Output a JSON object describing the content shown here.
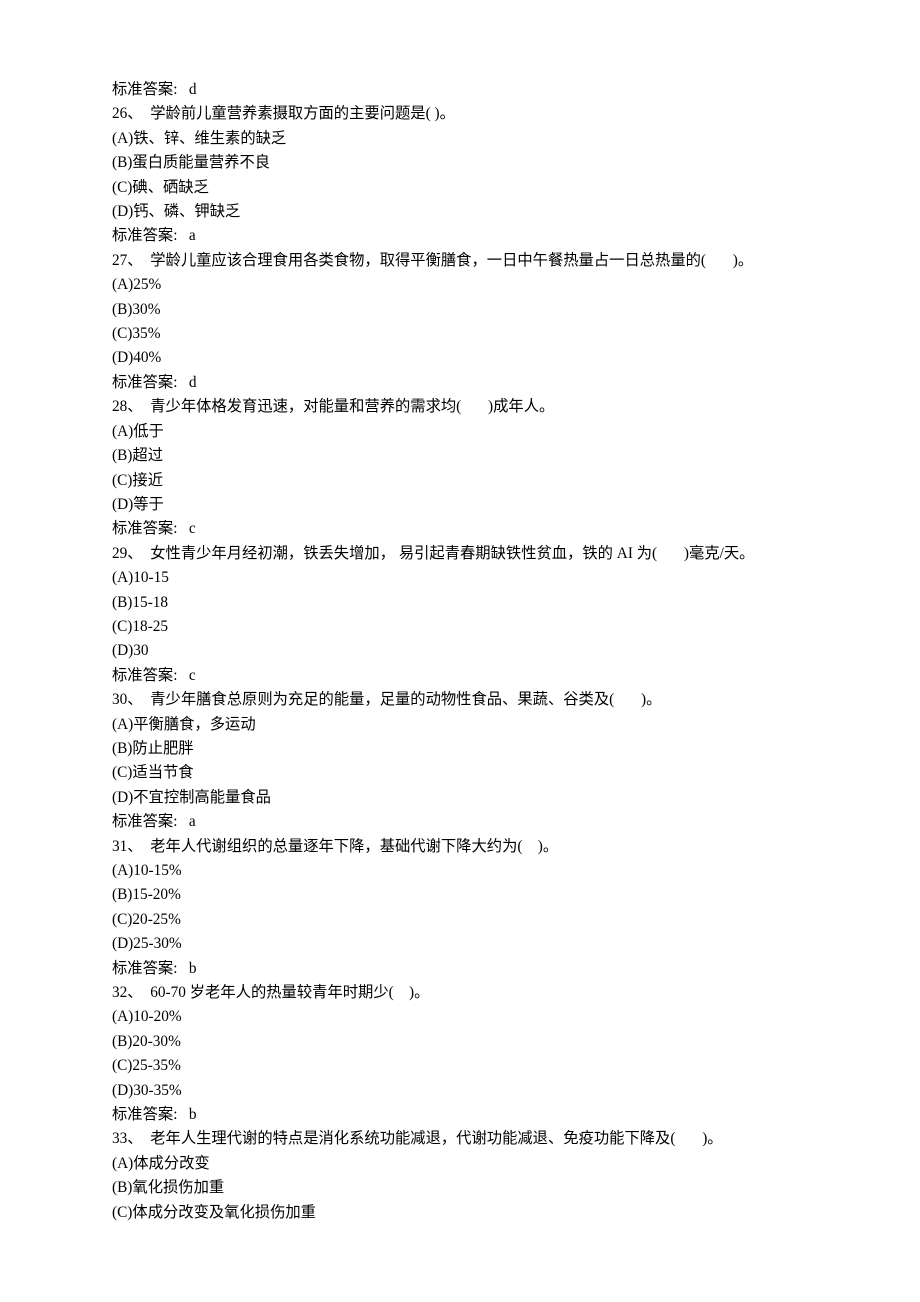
{
  "lines": [
    "标准答案:   d",
    "26、  学龄前儿童营养素摄取方面的主要问题是( )。",
    "(A)铁、锌、维生素的缺乏",
    "(B)蛋白质能量营养不良",
    "(C)碘、硒缺乏",
    "(D)钙、磷、钾缺乏",
    "标准答案:   a",
    "27、  学龄儿童应该合理食用各类食物，取得平衡膳食，一日中午餐热量占一日总热量的(       )。",
    "(A)25%",
    "(B)30%",
    "(C)35%",
    "(D)40%",
    "标准答案:   d",
    "28、  青少年体格发育迅速，对能量和营养的需求均(       )成年人。",
    "(A)低于",
    "(B)超过",
    "(C)接近",
    "(D)等于",
    "标准答案:   c",
    "29、  女性青少年月经初潮，铁丢失增加， 易引起青春期缺铁性贫血，铁的 AI 为(       )毫克/天。",
    "(A)10-15",
    "(B)15-18",
    "(C)18-25",
    "(D)30",
    "标准答案:   c",
    "30、  青少年膳食总原则为充足的能量，足量的动物性食品、果蔬、谷类及(       )。",
    "(A)平衡膳食，多运动",
    "(B)防止肥胖",
    "(C)适当节食",
    "(D)不宜控制高能量食品",
    "标准答案:   a",
    "31、  老年人代谢组织的总量逐年下降，基础代谢下降大约为(    )。",
    "(A)10-15%",
    "(B)15-20%",
    "(C)20-25%",
    "(D)25-30%",
    "标准答案:   b",
    "32、  60-70 岁老年人的热量较青年时期少(    )。",
    "(A)10-20%",
    "(B)20-30%",
    "(C)25-35%",
    "(D)30-35%",
    "标准答案:   b",
    "33、  老年人生理代谢的特点是消化系统功能减退，代谢功能减退、免疫功能下降及(       )。",
    "(A)体成分改变",
    "(B)氧化损伤加重",
    "(C)体成分改变及氧化损伤加重"
  ]
}
